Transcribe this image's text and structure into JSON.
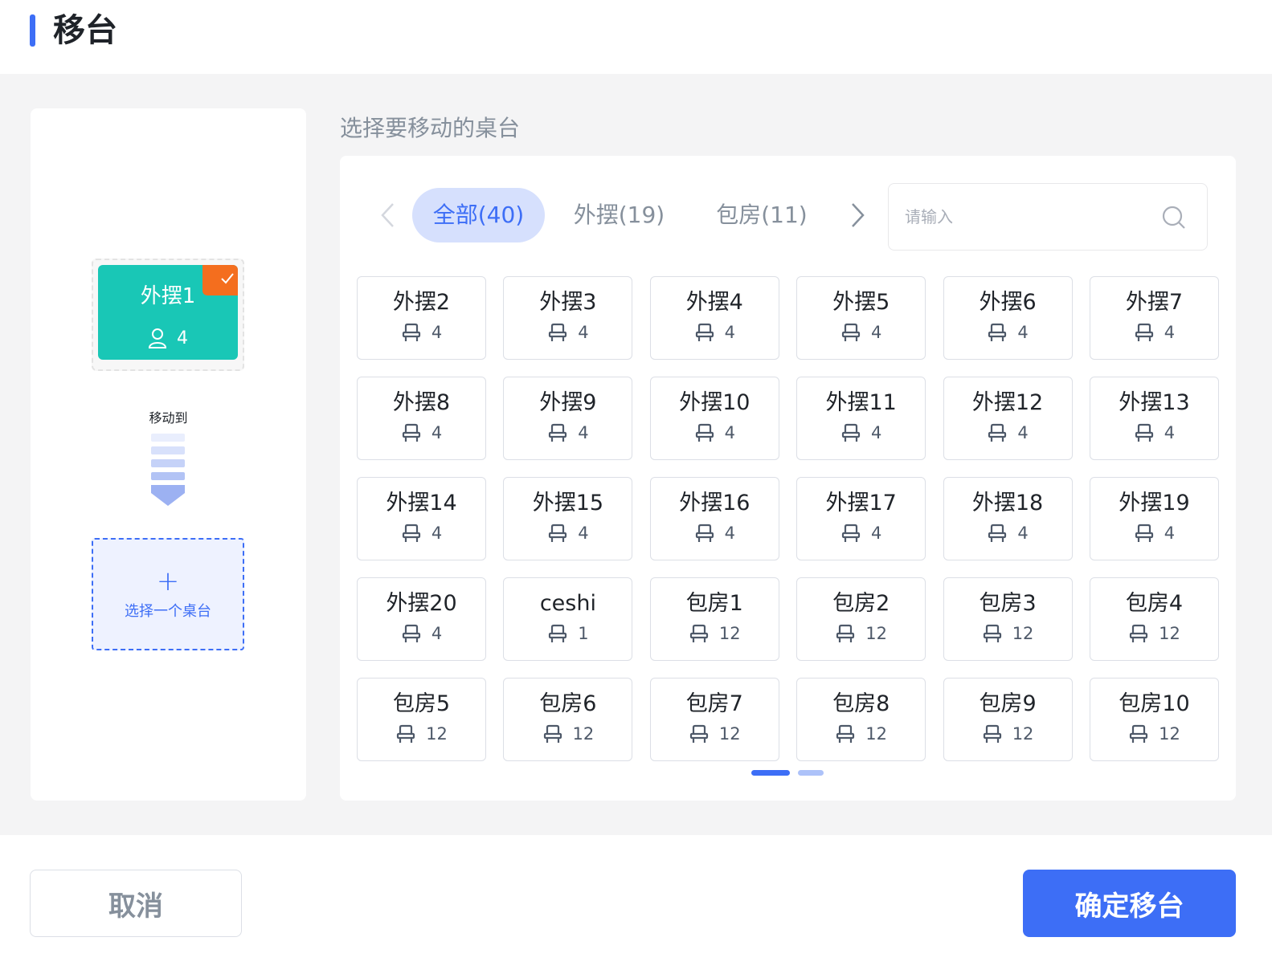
{
  "header": {
    "title": "移台"
  },
  "source_table": {
    "name": "外摆1",
    "seats": "4",
    "selected_icon": "check-icon",
    "seat_icon": "user-icon"
  },
  "move_label": "移动到",
  "target": {
    "placeholder_text": "选择一个桌台",
    "icon": "plus-icon"
  },
  "section_label": "选择要移动的桌台",
  "tabs": [
    {
      "label": "全部(40)",
      "active": true
    },
    {
      "label": "外摆(19)",
      "active": false
    },
    {
      "label": "包房(11)",
      "active": false
    }
  ],
  "search": {
    "placeholder": "请输入",
    "value": ""
  },
  "tables": [
    {
      "name": "外摆2",
      "seats": "4"
    },
    {
      "name": "外摆3",
      "seats": "4"
    },
    {
      "name": "外摆4",
      "seats": "4"
    },
    {
      "name": "外摆5",
      "seats": "4"
    },
    {
      "name": "外摆6",
      "seats": "4"
    },
    {
      "name": "外摆7",
      "seats": "4"
    },
    {
      "name": "外摆8",
      "seats": "4"
    },
    {
      "name": "外摆9",
      "seats": "4"
    },
    {
      "name": "外摆10",
      "seats": "4"
    },
    {
      "name": "外摆11",
      "seats": "4"
    },
    {
      "name": "外摆12",
      "seats": "4"
    },
    {
      "name": "外摆13",
      "seats": "4"
    },
    {
      "name": "外摆14",
      "seats": "4"
    },
    {
      "name": "外摆15",
      "seats": "4"
    },
    {
      "name": "外摆16",
      "seats": "4"
    },
    {
      "name": "外摆17",
      "seats": "4"
    },
    {
      "name": "外摆18",
      "seats": "4"
    },
    {
      "name": "外摆19",
      "seats": "4"
    },
    {
      "name": "外摆20",
      "seats": "4"
    },
    {
      "name": "ceshi",
      "seats": "1"
    },
    {
      "name": "包房1",
      "seats": "12"
    },
    {
      "name": "包房2",
      "seats": "12"
    },
    {
      "name": "包房3",
      "seats": "12"
    },
    {
      "name": "包房4",
      "seats": "12"
    },
    {
      "name": "包房5",
      "seats": "12"
    },
    {
      "name": "包房6",
      "seats": "12"
    },
    {
      "name": "包房7",
      "seats": "12"
    },
    {
      "name": "包房8",
      "seats": "12"
    },
    {
      "name": "包房9",
      "seats": "12"
    },
    {
      "name": "包房10",
      "seats": "12"
    }
  ],
  "pagination": {
    "current_page": 1,
    "total_pages": 2
  },
  "footer": {
    "cancel_label": "取消",
    "confirm_label": "确定移台"
  },
  "colors": {
    "accent": "#3d6ef6",
    "source_card": "#19c7b6",
    "selected_badge": "#f46e1e",
    "tab_active_bg": "#d6e0fd"
  }
}
